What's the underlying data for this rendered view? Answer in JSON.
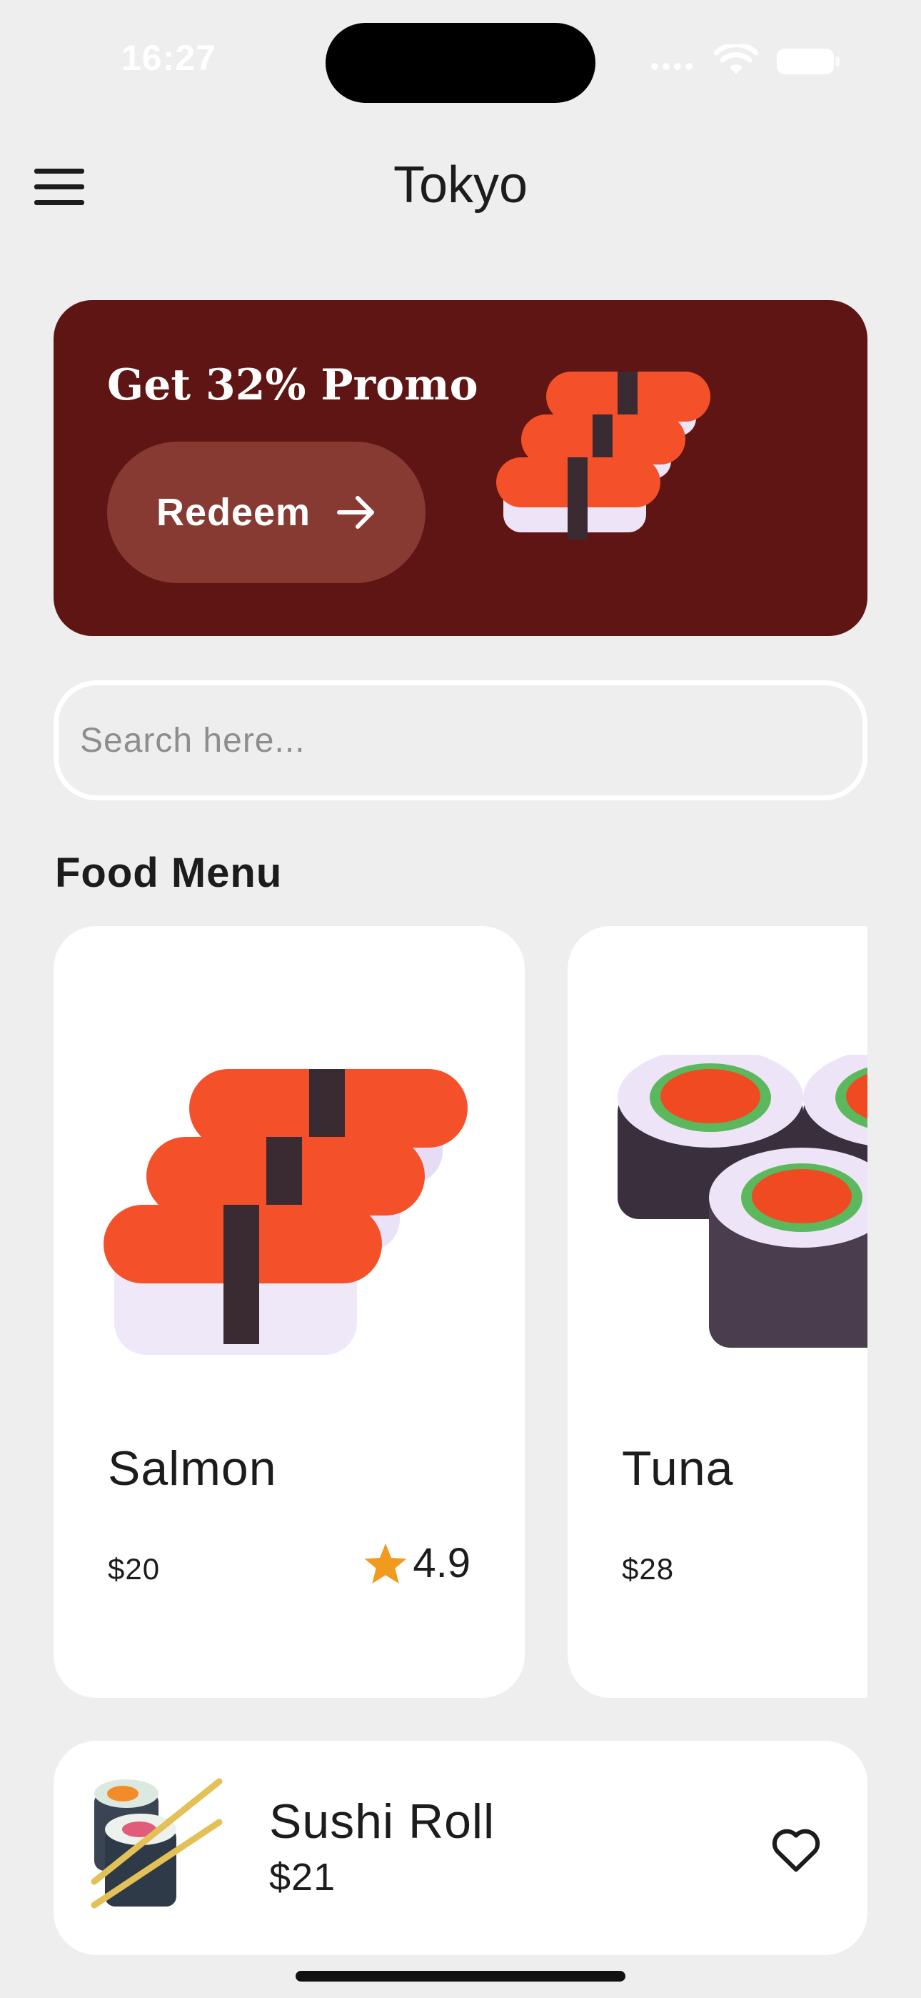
{
  "status_bar": {
    "time": "16:27"
  },
  "header": {
    "title": "Tokyo",
    "menu_icon": "hamburger-menu-icon"
  },
  "promo": {
    "title": "Get 32% Promo",
    "button_label": "Redeem",
    "button_icon": "arrow-right-icon",
    "background": "#5E1513",
    "button_color": "#873A32"
  },
  "search": {
    "placeholder": "Search here..."
  },
  "food_menu": {
    "title": "Food Menu",
    "items": [
      {
        "name": "Salmon",
        "price": "$20",
        "rating": "4.9",
        "image": "salmon-nigiri-image"
      },
      {
        "name": "Tuna",
        "price": "$28",
        "image": "tuna-maki-image"
      }
    ]
  },
  "favorite": {
    "name": "Sushi Roll",
    "price": "$21",
    "image": "sushi-roll-chopsticks-image",
    "icon": "heart-outline-icon"
  },
  "colors": {
    "background": "#EEEEEE",
    "card": "#FFFFFF",
    "star": "#F29A1E",
    "salmon": "#F4512A"
  }
}
